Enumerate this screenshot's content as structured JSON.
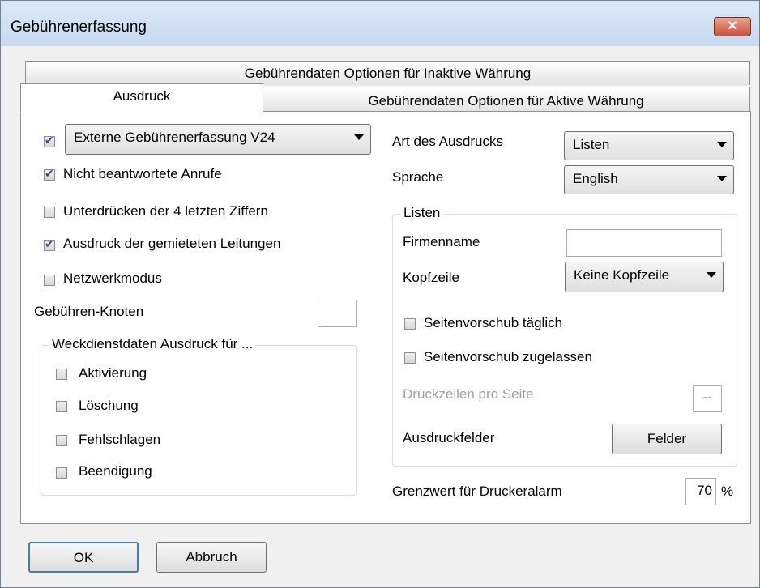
{
  "window": {
    "title": "Gebührenerfassung",
    "close_glyph": "✕"
  },
  "tabs": {
    "inactive_currency": "Gebührendaten Optionen für Inaktive Währung",
    "printout": "Ausdruck",
    "active_currency": "Gebührendaten Optionen für Aktive Währung"
  },
  "left": {
    "capture_select": "Externe Gebührenerfassung V24",
    "unanswered_calls": "Nicht beantwortete Anrufe",
    "suppress_digits": "Unterdrücken der 4 letzten Ziffern",
    "leased_lines": "Ausdruck der gemieteten Leitungen",
    "network_mode": "Netzwerkmodus",
    "charge_node_label": "Gebühren-Knoten",
    "charge_node_value": "",
    "wakeup_group": {
      "legend": "Weckdienstdaten Ausdruck für ...",
      "activation": "Aktivierung",
      "deletion": "Löschung",
      "failure": "Fehlschlagen",
      "termination": "Beendigung"
    }
  },
  "right": {
    "print_type_label": "Art des Ausdrucks",
    "print_type_value": "Listen",
    "language_label": "Sprache",
    "language_value": "English",
    "lists_group": {
      "legend": "Listen",
      "company_label": "Firmenname",
      "company_value": "",
      "header_label": "Kopfzeile",
      "header_value": "Keine Kopfzeile",
      "page_feed_daily": "Seitenvorschub täglich",
      "page_feed_allowed": "Seitenvorschub zugelassen",
      "lines_per_page_label": "Druckzeilen pro Seite",
      "lines_per_page_value": "--",
      "print_fields_label": "Ausdruckfelder",
      "fields_button": "Felder"
    },
    "printer_alarm_label": "Grenzwert für Druckeralarm",
    "printer_alarm_value": "70",
    "percent": "%"
  },
  "buttons": {
    "ok": "OK",
    "cancel": "Abbruch"
  },
  "checkbox_states": {
    "capture": true,
    "unanswered": true,
    "suppress": false,
    "leased": true,
    "network": false,
    "activation": false,
    "deletion": false,
    "failure": false,
    "termination": false,
    "feed_daily": false,
    "feed_allowed": false
  }
}
